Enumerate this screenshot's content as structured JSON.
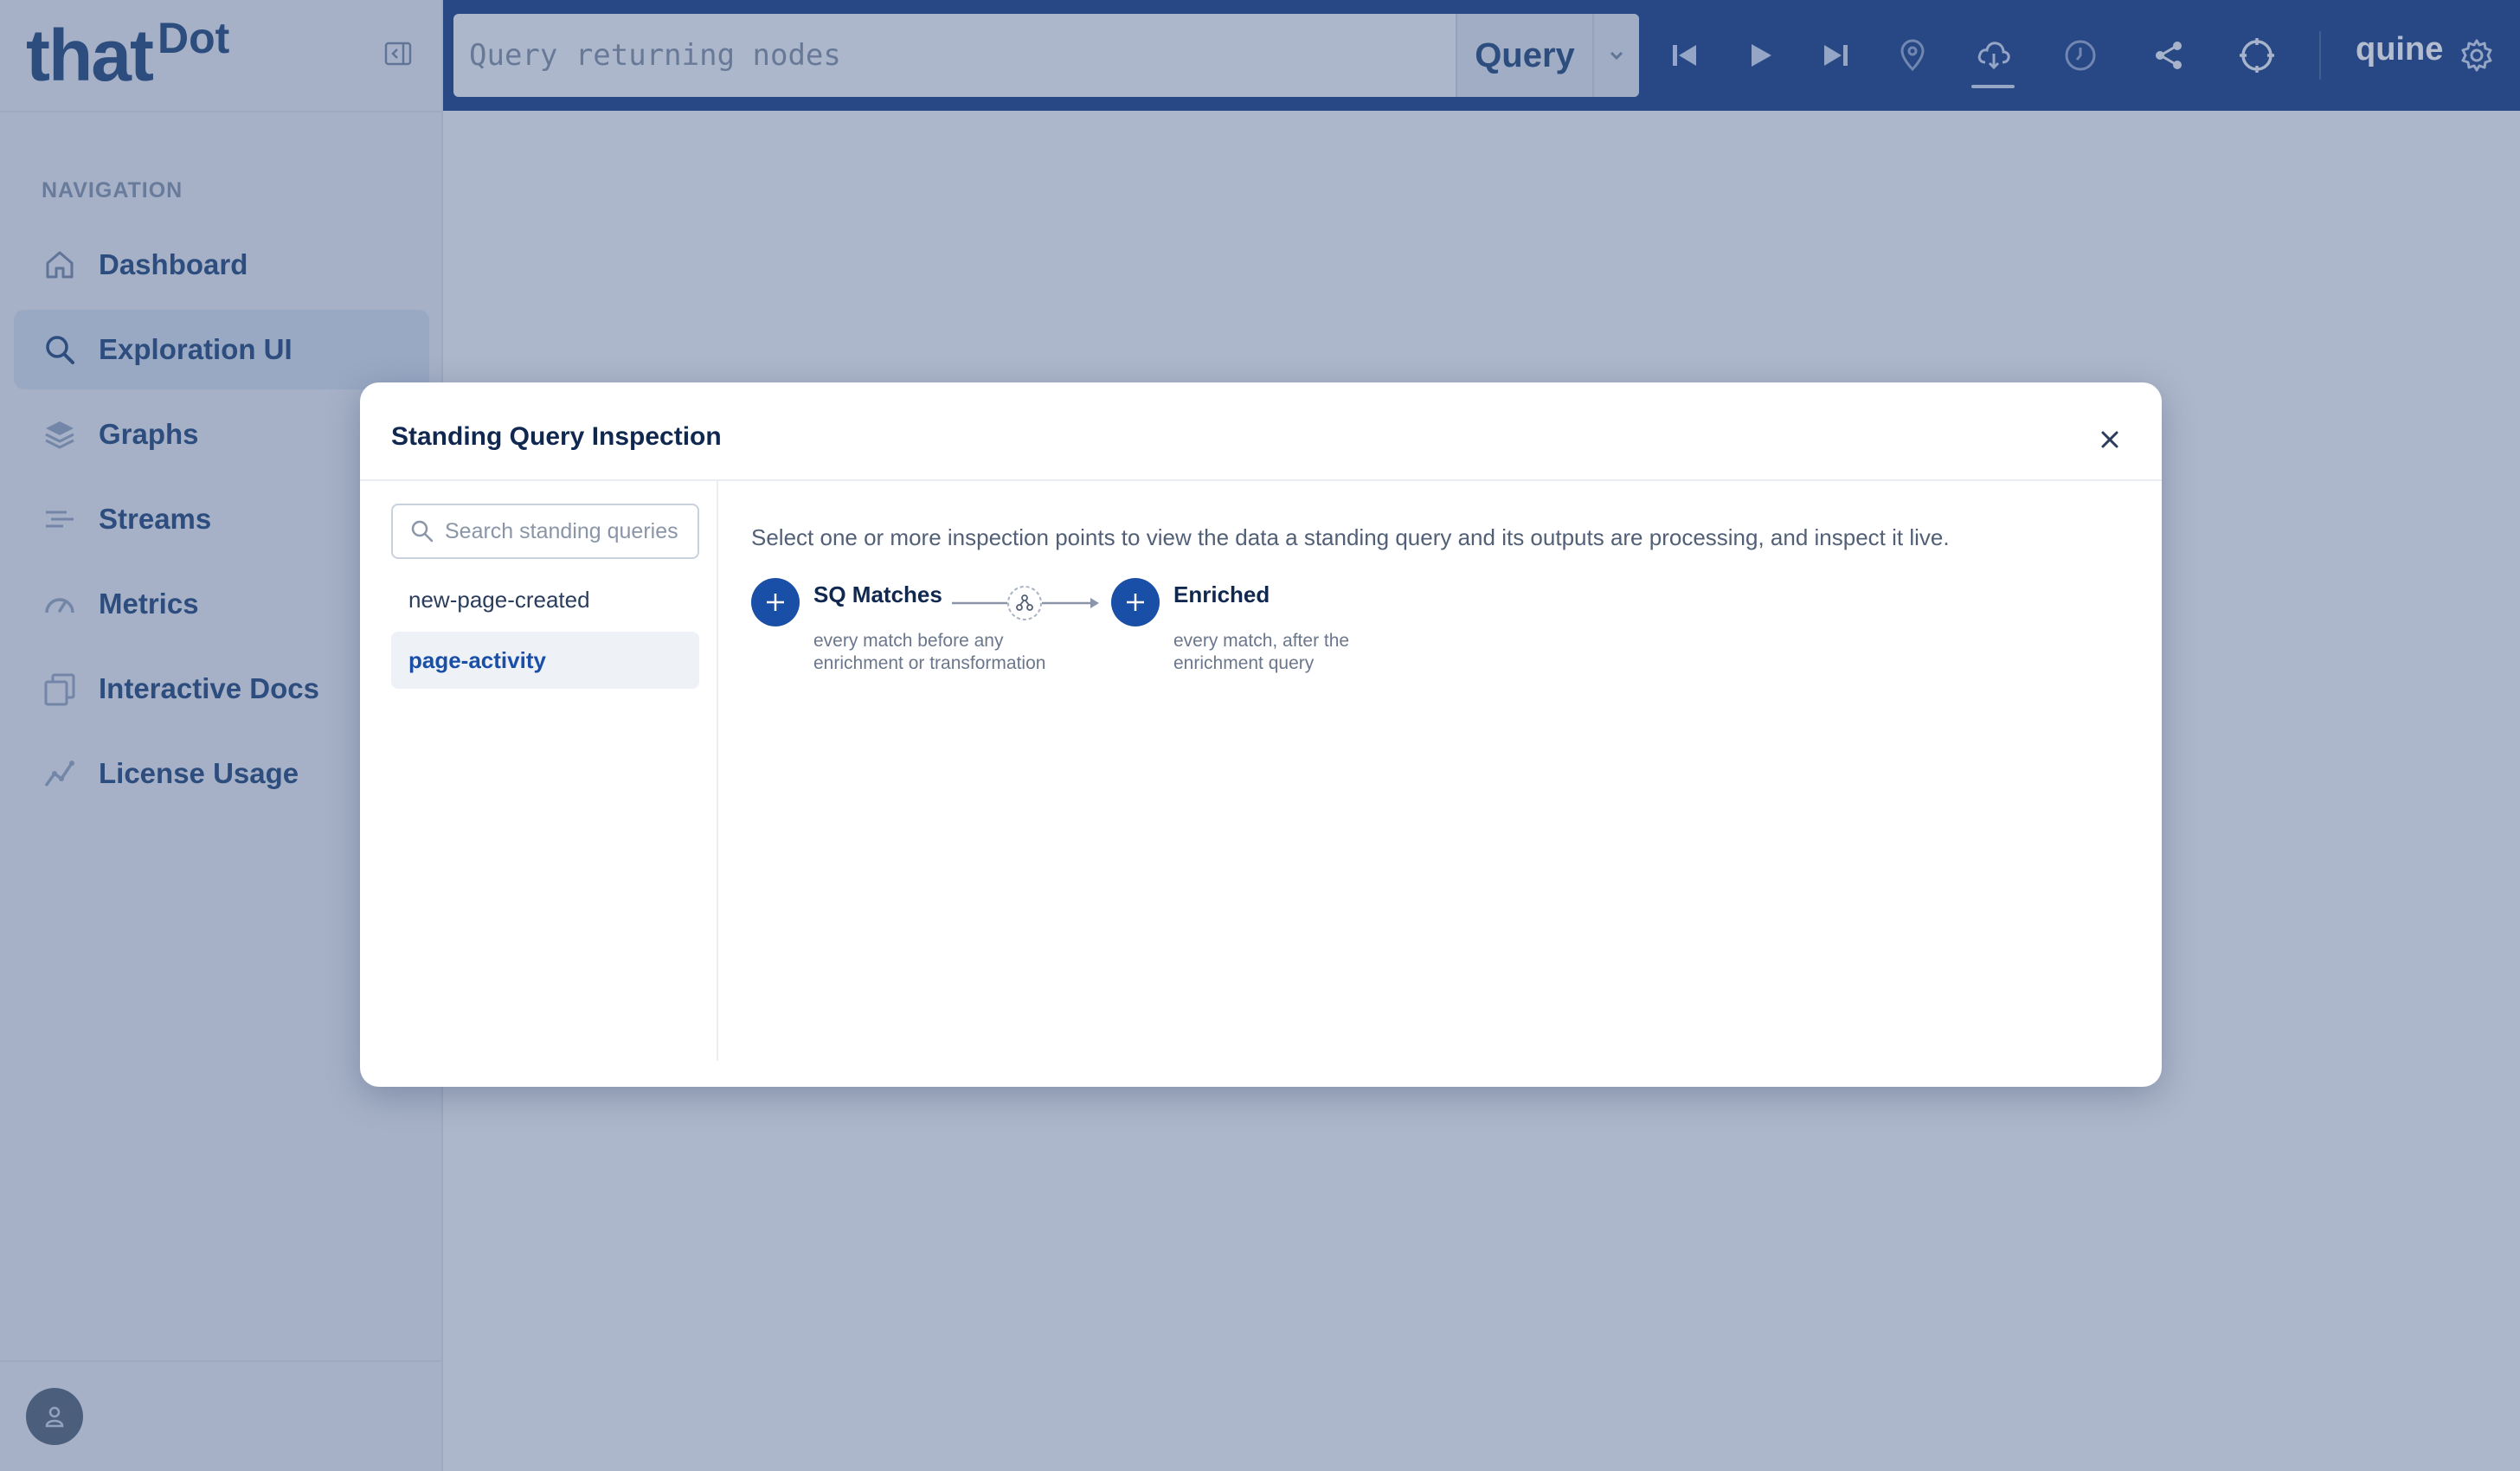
{
  "brand": {
    "that": "that",
    "dot": "Dot"
  },
  "sidebar": {
    "section_label": "NAVIGATION",
    "items": [
      {
        "label": "Dashboard",
        "icon": "home-icon",
        "active": false
      },
      {
        "label": "Exploration UI",
        "icon": "search-icon",
        "active": true
      },
      {
        "label": "Graphs",
        "icon": "layers-icon",
        "active": false
      },
      {
        "label": "Streams",
        "icon": "streams-icon",
        "active": false
      },
      {
        "label": "Metrics",
        "icon": "gauge-icon",
        "active": false
      },
      {
        "label": "Interactive Docs",
        "icon": "docs-icon",
        "active": false
      },
      {
        "label": "License Usage",
        "icon": "chart-line-icon",
        "active": false
      }
    ]
  },
  "topbar": {
    "query_placeholder": "Query returning nodes",
    "query_button": "Query",
    "user_label": "quine"
  },
  "modal": {
    "title": "Standing Query Inspection",
    "search_placeholder": "Search standing queries",
    "queries": [
      {
        "name": "new-page-created",
        "selected": false
      },
      {
        "name": "page-activity",
        "selected": true
      }
    ],
    "instructions": "Select one or more inspection points to view the data a standing query and its outputs are processing, and inspect it live.",
    "points": [
      {
        "title": "SQ Matches",
        "description": "every match before any enrichment or transformation"
      },
      {
        "title": "Enriched",
        "description": "every match, after the enrichment query"
      }
    ]
  },
  "colors": {
    "primary": "#1a4fa8",
    "topbar": "#0d3680",
    "overlay": "#4c628c"
  }
}
